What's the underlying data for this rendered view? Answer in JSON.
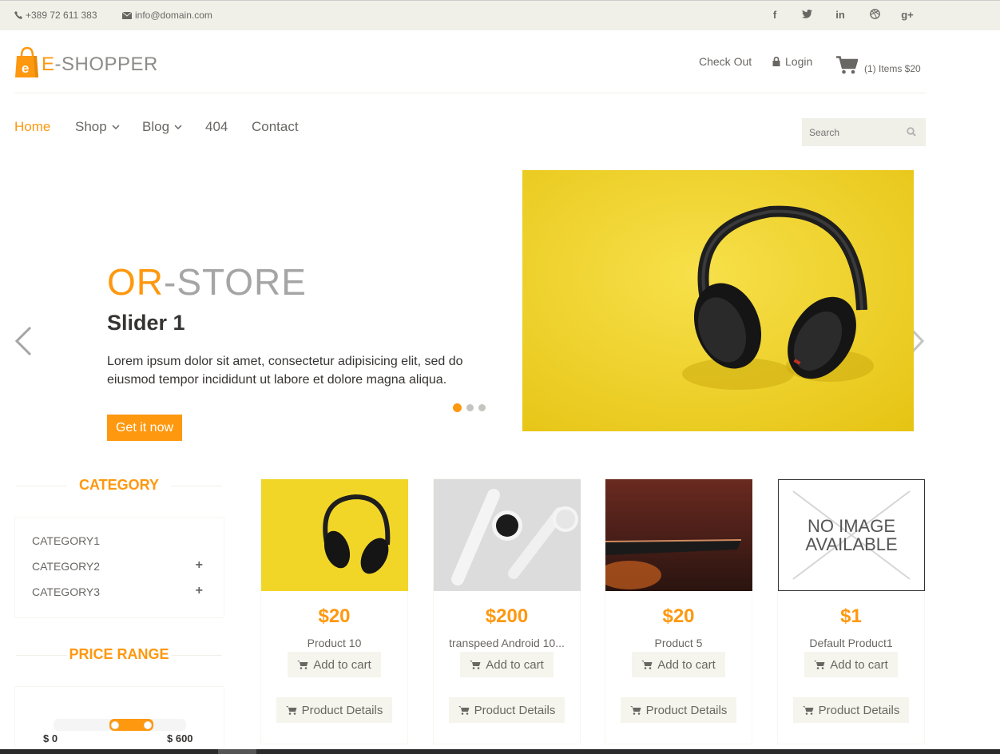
{
  "topbar": {
    "phone": "+389 72 611 383",
    "email": "info@domain.com",
    "social": [
      "f",
      "t",
      "in",
      "dribbble",
      "g+"
    ]
  },
  "header": {
    "brand_e": "E",
    "brand_rest": "-SHOPPER",
    "checkout": "Check Out",
    "login": "Login",
    "cart_text": "(1) Items $20"
  },
  "nav": {
    "home": "Home",
    "shop": "Shop",
    "blog": "Blog",
    "notfound": "404",
    "contact": "Contact",
    "search_placeholder": "Search"
  },
  "slider": {
    "title_a": "OR",
    "title_b": "-STORE",
    "subtitle": "Slider 1",
    "description": "Lorem ipsum dolor sit amet, consectetur adipisicing elit, sed do eiusmod tempor incididunt ut labore et dolore magna aliqua.",
    "button": "Get it now",
    "active_slide": 1,
    "total_slides": 3
  },
  "sidebar": {
    "category_title": "CATEGORY",
    "categories": [
      {
        "label": "CATEGORY1",
        "expandable": false
      },
      {
        "label": "CATEGORY2",
        "expandable": true
      },
      {
        "label": "CATEGORY3",
        "expandable": true
      }
    ],
    "price_title": "PRICE RANGE",
    "price_min": "$ 0",
    "price_max": "$ 600"
  },
  "products": [
    {
      "price": "$20",
      "name": "Product 10",
      "add": "Add to cart",
      "details": "Product Details",
      "image": "headphones"
    },
    {
      "price": "$200",
      "name": "transpeed Android 10...",
      "add": "Add to cart",
      "details": "Product Details",
      "image": "smartwatches"
    },
    {
      "price": "$20",
      "name": "Product 5",
      "add": "Add to cart",
      "details": "Product Details",
      "image": "phone"
    },
    {
      "price": "$1",
      "name": "Default Product1",
      "add": "Add to cart",
      "details": "Product Details",
      "image": "no-image",
      "noimg_line1": "NO IMAGE",
      "noimg_line2": "AVAILABLE"
    }
  ],
  "colors": {
    "accent": "#FE980F",
    "topbar": "#f0f0e9",
    "text": "#696763",
    "hero_bg": "#f2d21f"
  }
}
